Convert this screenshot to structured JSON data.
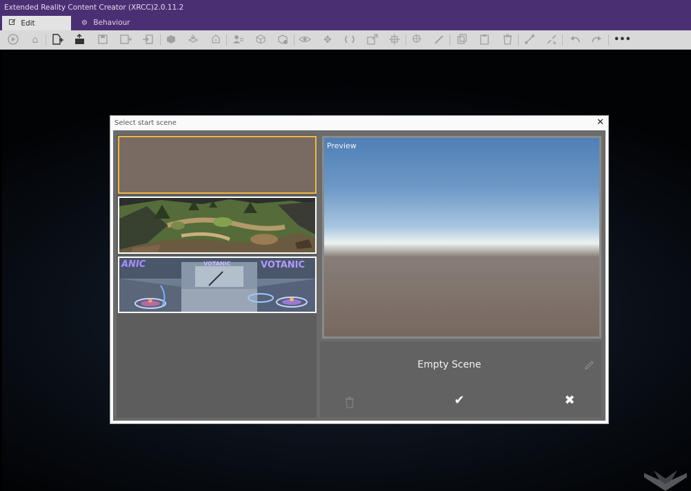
{
  "window": {
    "title": "Extended Reality Content Creator (XRCC)2.0.11.2"
  },
  "tabs": [
    {
      "label": "Edit",
      "icon": "edit-icon",
      "active": true
    },
    {
      "label": "Behaviour",
      "icon": "gear-icon",
      "active": false
    }
  ],
  "toolbar": {
    "icons": [
      "play",
      "home",
      "new-scene",
      "open",
      "save",
      "save-as",
      "export",
      "import-model",
      "import-asset",
      "import-media",
      "avatar",
      "box",
      "package",
      "visibility",
      "move",
      "rotate",
      "scale",
      "pivot",
      "snap",
      "brush",
      "copy",
      "paste",
      "delete",
      "link",
      "unlink",
      "undo",
      "redo"
    ],
    "more_label": "•••"
  },
  "dialog": {
    "title": "Select start scene",
    "close_label": "✕",
    "scenes": [
      {
        "name": "Empty Scene",
        "selected": true
      },
      {
        "name": "Forest",
        "selected": false
      },
      {
        "name": "Votanic",
        "selected": false
      }
    ],
    "thumb_text": {
      "votanic_left": "ANIC",
      "votanic_center": "VOTANIC",
      "votanic_right": "VOTANIC"
    },
    "preview_label": "Preview",
    "selected_name": "Empty Scene",
    "confirm_label": "✔",
    "cancel_label": "✖"
  },
  "colors": {
    "title_bar": "#4b2f73",
    "toolbar": "#d9d9d9",
    "selected_border": "#f2b448",
    "dialog_bg": "#6b6b6b"
  }
}
